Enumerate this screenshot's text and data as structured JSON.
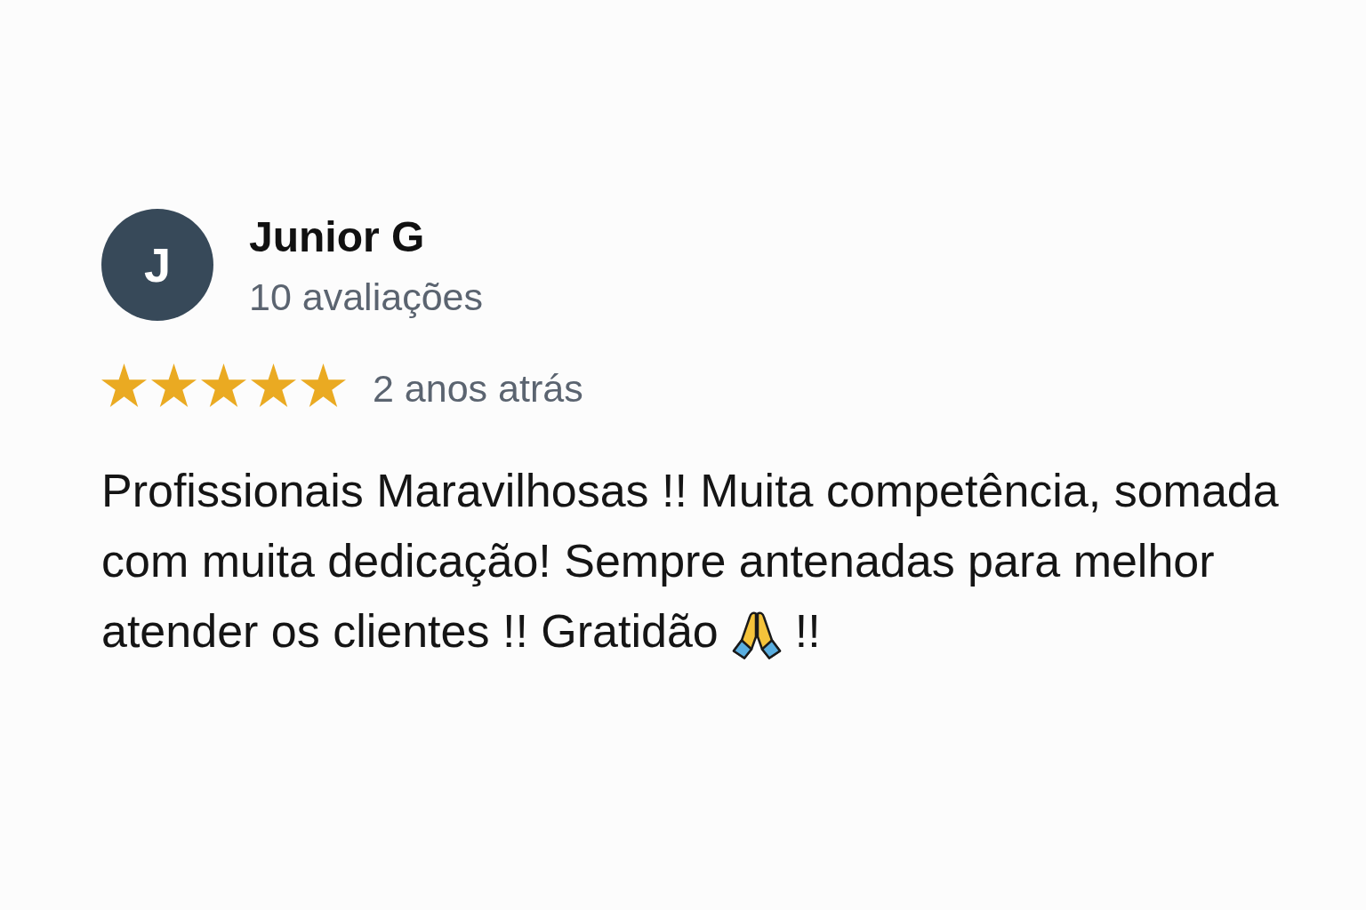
{
  "reviewer": {
    "avatar_initial": "J",
    "name": "Junior G",
    "reviews_count": "10 avaliações"
  },
  "review": {
    "stars": 5,
    "time": "2 anos atrás",
    "body_lines": [
      {
        "segments": [
          {
            "kind": "text",
            "text": "Profissionais Maravilhosas !! Muita competência, somada"
          }
        ]
      },
      {
        "segments": [
          {
            "kind": "text",
            "text": "com muita dedicação! Sempre antenadas para melhor"
          }
        ]
      },
      {
        "segments": [
          {
            "kind": "text",
            "text": "atender os clientes !! Gratidão"
          },
          {
            "kind": "emoji"
          },
          {
            "kind": "text",
            "text": "!!"
          }
        ]
      }
    ]
  }
}
